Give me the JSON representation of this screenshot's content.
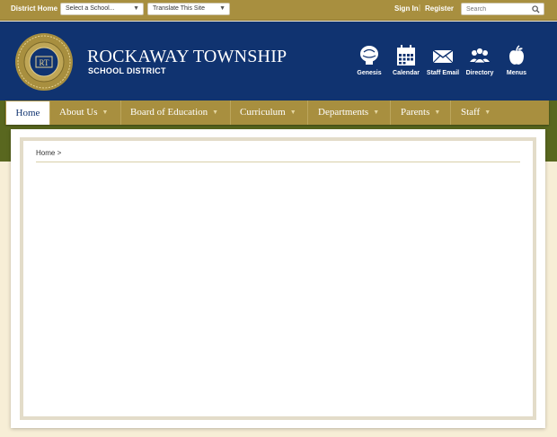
{
  "topbar": {
    "district_home": "District Home",
    "school_select": "Select a School...",
    "translate_select": "Translate This Site",
    "sign_in": "Sign In",
    "separator": "|",
    "register": "Register",
    "search_placeholder": "Search"
  },
  "header": {
    "name": "ROCKAWAY TOWNSHIP",
    "subtitle": "SCHOOL DISTRICT",
    "seal_initials": "RT",
    "quick_links": [
      {
        "label": "Genesis",
        "icon": "genesis-icon"
      },
      {
        "label": "Calendar",
        "icon": "calendar-icon"
      },
      {
        "label": "Staff Email",
        "icon": "envelope-icon"
      },
      {
        "label": "Directory",
        "icon": "people-icon"
      },
      {
        "label": "Menus",
        "icon": "apple-icon"
      }
    ]
  },
  "nav": {
    "items": [
      {
        "label": "Home"
      },
      {
        "label": "About Us"
      },
      {
        "label": "Board of Education"
      },
      {
        "label": "Curriculum"
      },
      {
        "label": "Departments"
      },
      {
        "label": "Parents"
      },
      {
        "label": "Staff"
      }
    ]
  },
  "breadcrumb": {
    "text": "Home",
    "separator": ">"
  },
  "colors": {
    "gold": "#a88f3f",
    "navy": "#103370",
    "green": "#59671f",
    "cream": "#f7eed6"
  }
}
